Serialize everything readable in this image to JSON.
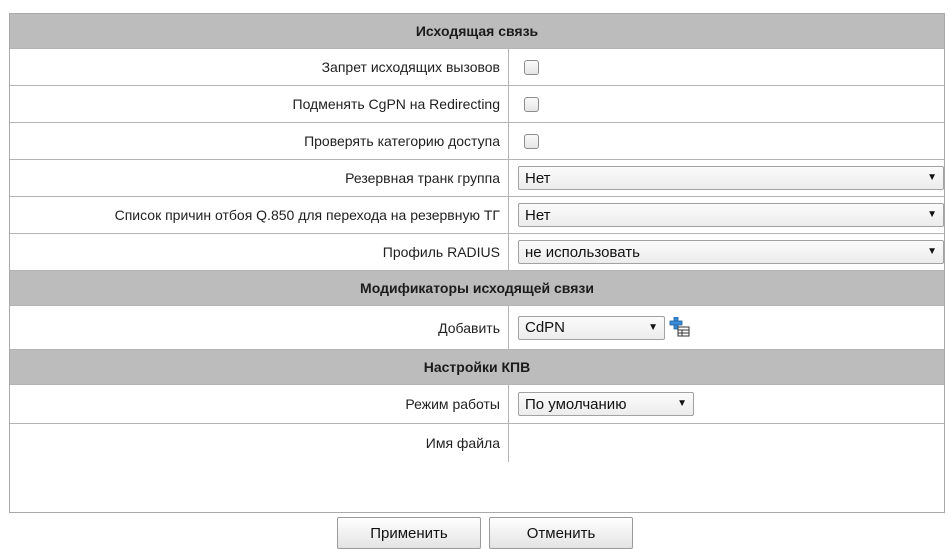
{
  "outgoing": {
    "title": "Исходящая связь",
    "rows": [
      {
        "label": "Запрет исходящих вызовов"
      },
      {
        "label": "Подменять CgPN на Redirecting"
      },
      {
        "label": "Проверять категорию доступа"
      }
    ],
    "reserve_trunk_label": "Резервная транк группа",
    "reserve_trunk_value": "Нет",
    "q850_label": "Список причин отбоя Q.850 для перехода на резервную ТГ",
    "q850_value": "Нет",
    "radius_label": "Профиль RADIUS",
    "radius_value": "не использовать"
  },
  "modifiers": {
    "title": "Модификаторы исходящей связи",
    "add_label": "Добавить",
    "add_value": "CdPN"
  },
  "kpv": {
    "title": "Настройки КПВ",
    "mode_label": "Режим работы",
    "mode_value": "По умолчанию",
    "file_label": "Имя файла"
  },
  "actions": {
    "apply": "Применить",
    "cancel": "Отменить"
  },
  "icons": {
    "dropdown": "triangle-down-icon",
    "add": "add-modifier-icon"
  },
  "colors": {
    "section_bg": "#bcbcbc",
    "border": "#b4b4b4",
    "add_icon": "#3a8dd8"
  }
}
